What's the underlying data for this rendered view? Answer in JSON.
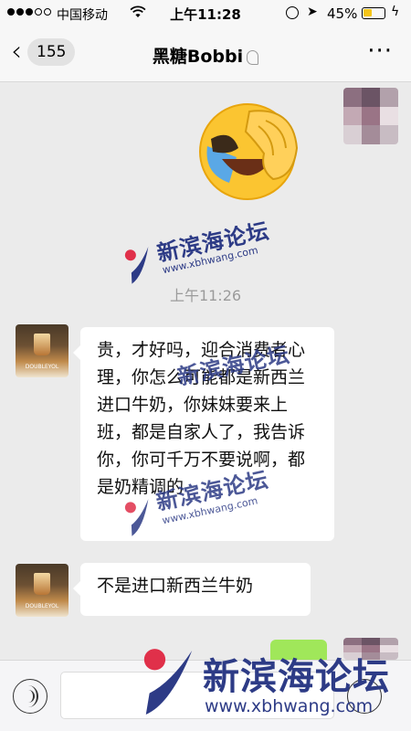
{
  "status_bar": {
    "carrier": "中国移动",
    "time": "上午11:28",
    "battery_percent": "45%",
    "battery_level": 0.45,
    "icons": [
      "signal-dots-icon",
      "wifi-icon",
      "rotation-lock-icon",
      "location-arrow-icon",
      "battery-icon",
      "charging-bolt-icon"
    ]
  },
  "nav": {
    "back_count": "155",
    "title": "黑糖Bobbi",
    "icons": [
      "back-chevron-icon",
      "ear-icon",
      "more-icon"
    ]
  },
  "chat": {
    "timestamp": "上午11:26",
    "messages": [
      {
        "sender": "friend",
        "text": "贵，才好吗，迎合消费者心理，你怎么可能都是新西兰进口牛奶，你妹妹要来上班，都是自家人了，我告诉你，你可千万不要说啊，都是奶精调的"
      },
      {
        "sender": "friend",
        "text": "不是进口新西兰牛奶"
      }
    ],
    "sticker": "face-palm-laughing-emoji"
  },
  "watermark": {
    "name": "新滨海论坛",
    "url": "www.xbhwang.com"
  },
  "input_bar": {
    "icons": [
      "voice-icon",
      "emoji-icon"
    ]
  },
  "colors": {
    "background": "#ebebeb",
    "bar_background": "#f7f7f7",
    "self_bubble": "#a0e75a",
    "watermark_blue": "#2d3b86",
    "watermark_red": "#e0304a",
    "battery_yellow": "#f5c518"
  }
}
